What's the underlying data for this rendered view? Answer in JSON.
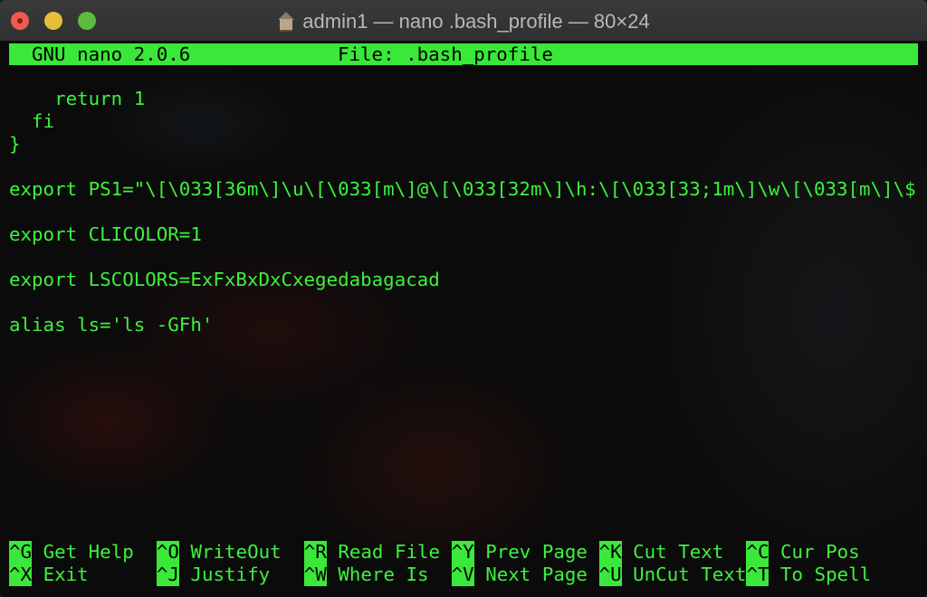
{
  "window": {
    "title": "admin1 — nano .bash_profile — 80×24",
    "title_icon": "house-icon"
  },
  "nano": {
    "version": "GNU nano 2.0.6",
    "file": "File: .bash_profile"
  },
  "lines": [
    "",
    "    return 1",
    "  fi",
    "}",
    "",
    "export PS1=\"\\[\\033[36m\\]\\u\\[\\033[m\\]@\\[\\033[32m\\]\\h:\\[\\033[33;1m\\]\\w\\[\\033[m\\]\\$",
    "",
    "export CLICOLOR=1",
    "",
    "export LSCOLORS=ExFxBxDxCxegedabagacad",
    "",
    "alias ls='ls -GFh'"
  ],
  "shortcuts": [
    [
      {
        "key": "^G",
        "label": "Get Help"
      },
      {
        "key": "^O",
        "label": "WriteOut"
      },
      {
        "key": "^R",
        "label": "Read File"
      },
      {
        "key": "^Y",
        "label": "Prev Page"
      },
      {
        "key": "^K",
        "label": "Cut Text"
      },
      {
        "key": "^C",
        "label": "Cur Pos"
      }
    ],
    [
      {
        "key": "^X",
        "label": "Exit"
      },
      {
        "key": "^J",
        "label": "Justify"
      },
      {
        "key": "^W",
        "label": "Where Is"
      },
      {
        "key": "^V",
        "label": "Next Page"
      },
      {
        "key": "^U",
        "label": "UnCut Text"
      },
      {
        "key": "^T",
        "label": "To Spell"
      }
    ]
  ],
  "colors": {
    "terminal_green": "#3cf23c",
    "background": "#0b0b0b"
  }
}
